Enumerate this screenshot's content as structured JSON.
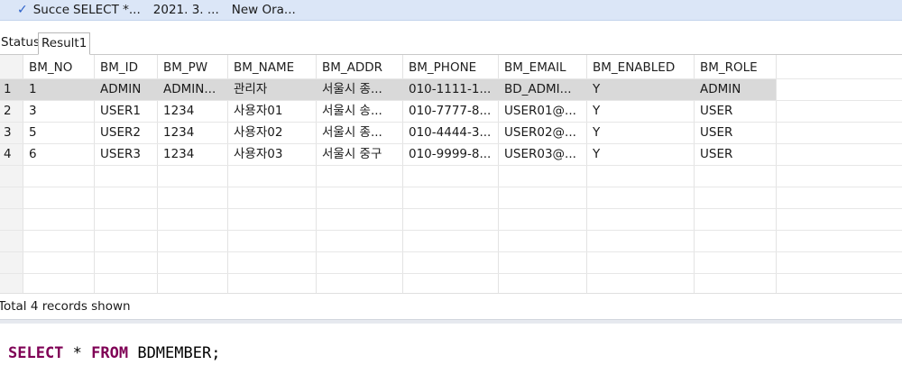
{
  "history": {
    "status": "Succe",
    "sql": "SELECT *...",
    "date": "2021. 3. ...",
    "connection": "New Ora..."
  },
  "tabs": {
    "status": "Status",
    "result": "Result1"
  },
  "grid": {
    "columns": [
      "BM_NO",
      "BM_ID",
      "BM_PW",
      "BM_NAME",
      "BM_ADDR",
      "BM_PHONE",
      "BM_EMAIL",
      "BM_ENABLED",
      "BM_ROLE"
    ],
    "rows": [
      {
        "num": "1",
        "cells": [
          "1",
          "ADMIN",
          "ADMIN...",
          "관리자",
          "서울시 종...",
          "010-1111-1...",
          "BD_ADMI...",
          "Y",
          "ADMIN"
        ]
      },
      {
        "num": "2",
        "cells": [
          "3",
          "USER1",
          "1234",
          "사용자01",
          "서울시 송...",
          "010-7777-8...",
          "USER01@...",
          "Y",
          "USER"
        ]
      },
      {
        "num": "3",
        "cells": [
          "5",
          "USER2",
          "1234",
          "사용자02",
          "서울시 종...",
          "010-4444-3...",
          "USER02@...",
          "Y",
          "USER"
        ]
      },
      {
        "num": "4",
        "cells": [
          "6",
          "USER3",
          "1234",
          "사용자03",
          "서울시 중구",
          "010-9999-8...",
          "USER03@...",
          "Y",
          "USER"
        ]
      }
    ]
  },
  "footer": {
    "total": "Total 4 records shown"
  },
  "editor": {
    "kw1": "SELECT",
    "star": " * ",
    "kw2": "FROM",
    "rest": " BDMEMBER;"
  },
  "colors": {
    "history_bg": "#dbe6f7",
    "selected_row": "#d9d9d9",
    "keyword": "#7f0055"
  }
}
